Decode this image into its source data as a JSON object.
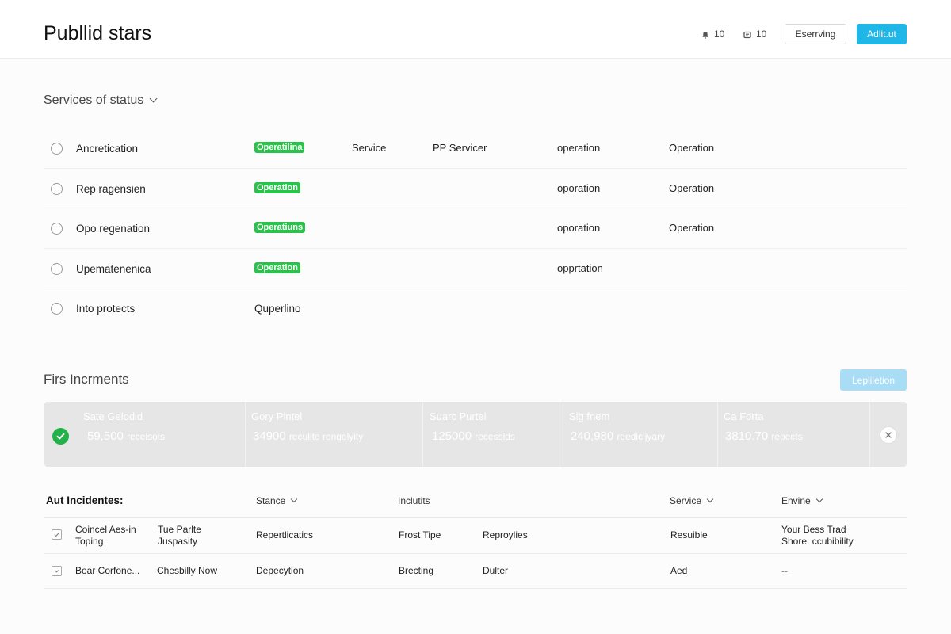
{
  "header": {
    "title": "Publlid stars",
    "stat_1": "10",
    "stat_2": "10",
    "outline_button": "Eserrving",
    "primary_button": "Adlit.ut",
    "accent": "#1fb6e8"
  },
  "services": {
    "title": "Services of status",
    "rows": [
      {
        "name": "Ancretication",
        "status": "Operatilina",
        "col3": "Service",
        "col4": "PP Servicer",
        "col5": "operation",
        "col6": "Operation"
      },
      {
        "name": "Rep ragensien",
        "status": "Operation",
        "col3": "",
        "col4": "",
        "col5": "oporation",
        "col6": "Operation"
      },
      {
        "name": "Opo regenation",
        "status": "Operatiuns",
        "col3": "",
        "col4": "",
        "col5": "oporation",
        "col6": "Operation"
      },
      {
        "name": "Upematenenica",
        "status": "Operation",
        "col3": "",
        "col4": "",
        "col5": "opprtation",
        "col6": ""
      },
      {
        "name": "Into protects",
        "status": "",
        "plain_status": "Quperlino",
        "col3": "",
        "col4": "",
        "col5": "",
        "col6": ""
      }
    ],
    "status_color": "#29c24a"
  },
  "increments": {
    "title": "Firs Incrments",
    "button": "Lepliletion",
    "cells": [
      {
        "title": "Sate Gelodid",
        "value": "59,500",
        "unit": "receisots"
      },
      {
        "title": "Gory Pintel",
        "value": "34900",
        "unit": "reculite rengolyity"
      },
      {
        "title": "Suarc Purtel",
        "value": "125000",
        "unit": "recesslds"
      },
      {
        "title": "Sig fnem",
        "value": "240,980",
        "unit": "reedicljyary"
      },
      {
        "title": "Ca Forta",
        "value": "3810.70",
        "unit": "reoects"
      }
    ]
  },
  "incidents": {
    "title": "Aut Incidentes:",
    "columns": {
      "status": "Stance",
      "incidents": "Inclutits",
      "service": "Service",
      "envine": "Envine"
    },
    "rows": [
      {
        "c1a": "Coincel Aes-in",
        "c1b": "Toping",
        "c2a": "Tue Parlte",
        "c2b": "Juspasity",
        "c3": "Repertlicatics",
        "c4": "Frost Tipe",
        "c5": "Reproylies",
        "c6": "Resuible",
        "c7a": "Your Bess Trad",
        "c7b": "Shore. ccubibility"
      },
      {
        "c1a": "Boar Corfone...",
        "c1b": "",
        "c2a": "Chesbilly Now",
        "c2b": "",
        "c3": "Depecytion",
        "c4": "Brecting",
        "c5": "Dulter",
        "c6": "Aed",
        "c7a": "--",
        "c7b": ""
      }
    ]
  }
}
